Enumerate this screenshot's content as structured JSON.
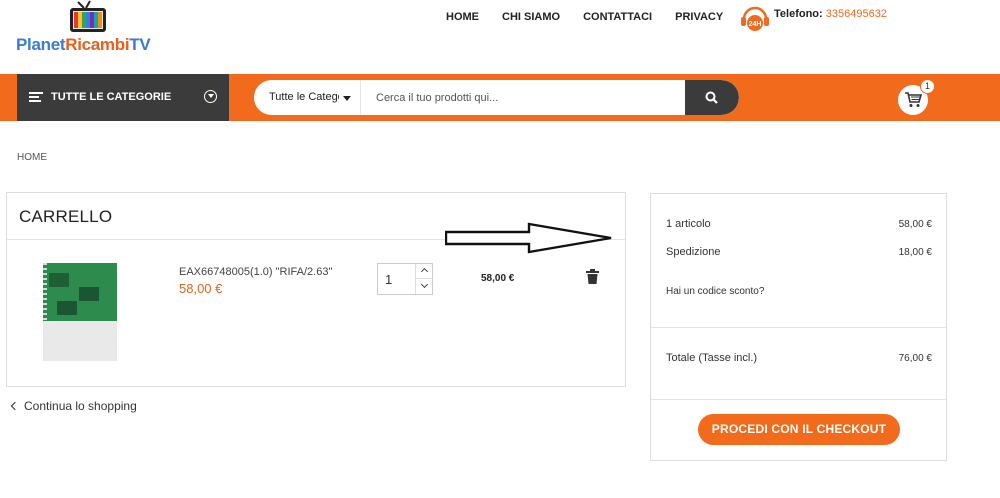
{
  "header": {
    "logo": {
      "part1": "Planet",
      "part2": "Ricambi",
      "part3": "TV"
    },
    "nav": [
      {
        "label": "HOME"
      },
      {
        "label": "CHI SIAMO"
      },
      {
        "label": "CONTATTACI"
      },
      {
        "label": "PRIVACY"
      }
    ],
    "phone": {
      "badge": "24H",
      "label": "Telefono:",
      "number": "3356495632"
    }
  },
  "toolbar": {
    "categories_label": "TUTTE LE CATEGORIE",
    "category_select": "Tutte le Categorie",
    "search_placeholder": "Cerca il tuo prodotti qui...",
    "cart_count": "1",
    "accent_color": "#f26a1b",
    "dark_color": "#3b3b3b"
  },
  "breadcrumb": "HOME",
  "cart": {
    "title": "CARRELLO",
    "items": [
      {
        "name": "EAX66748005(1.0) \"RIFA/2.63\"",
        "price": "58,00 €",
        "quantity": "1",
        "line_total": "58,00 €"
      }
    ],
    "continue_label": "Continua lo shopping"
  },
  "summary": {
    "items_label": "1 articolo",
    "items_value": "58,00 €",
    "shipping_label": "Spedizione",
    "shipping_value": "18,00 €",
    "promo_label": "Hai un codice sconto?",
    "total_label": "Totale (Tasse incl.)",
    "total_value": "76,00 €",
    "checkout_label": "PROCEDI CON IL CHECKOUT"
  }
}
